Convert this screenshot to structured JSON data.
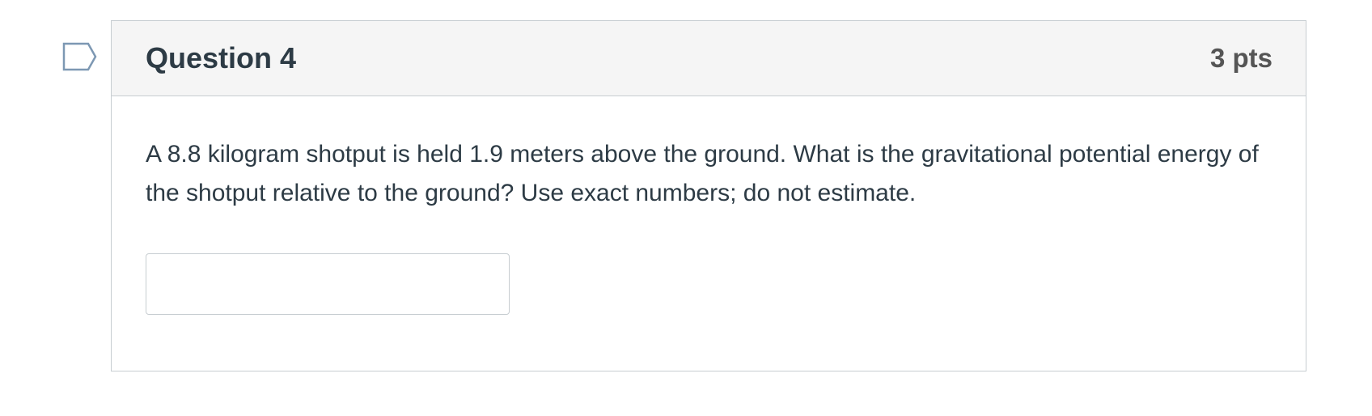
{
  "question": {
    "title": "Question 4",
    "points": "3 pts",
    "text": "A 8.8 kilogram shotput is held 1.9 meters above the ground. What is the gravitational potential energy of the shotput relative to the ground? Use exact numbers; do not estimate.",
    "answer_value": "",
    "answer_placeholder": ""
  },
  "icons": {
    "flag": "flag-question-icon"
  },
  "colors": {
    "header_background": "#f5f5f5",
    "border": "#c7cdd1",
    "text": "#2d3b45",
    "points_text": "#555555",
    "flag_outline": "#7d98b3"
  }
}
